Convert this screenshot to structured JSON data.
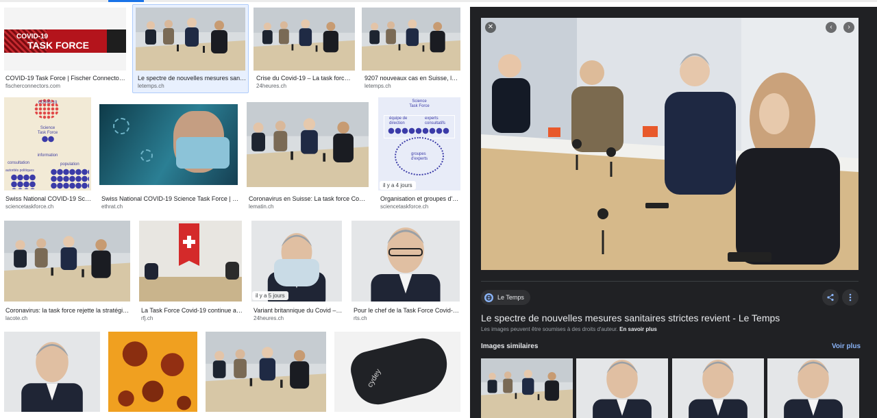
{
  "results": [
    {
      "title": "COVID-19 Task Force | Fischer Connectors S...",
      "source": "fischerconnectors.com",
      "banner_line1": "COVID-19",
      "banner_line2": "TASK FORCE"
    },
    {
      "title": "Le spectre de nouvelles mesures sanita...",
      "source": "letemps.ch",
      "selected": true
    },
    {
      "title": "Crise du Covid-19 – La task force p...",
      "source": "24heures.ch"
    },
    {
      "title": "9207 nouveaux cas en Suisse, la ca...",
      "source": "letemps.ch"
    },
    {
      "title": "Swiss National COVID-19 Scie...",
      "source": "sciencetaskforce.ch",
      "diagram": {
        "top": "COVID-19",
        "sub": "Science\nTask Force",
        "info": "information",
        "left": "consultation",
        "right": "population",
        "bottom": "autorités politiques"
      }
    },
    {
      "title": "Swiss National COVID-19 Science Task Force | Con...",
      "source": "ethrat.ch"
    },
    {
      "title": "Coronavirus en Suisse: La task force Covid-1...",
      "source": "lematin.ch"
    },
    {
      "title": "Organisation et groupes d'ex...",
      "source": "sciencetaskforce.ch",
      "badge": "il y a 4 jours",
      "diagram": {
        "top": "Science\nTask Force",
        "left": "équipe de\ndirection",
        "right": "experts\nconsultatifs",
        "bottom": "groupes\nd'experts"
      }
    },
    {
      "title": "Coronavirus: la task force rejette la stratégie d...",
      "source": "lacote.ch"
    },
    {
      "title": "La Task Force Covid-19 continue ave...",
      "source": "rfj.ch"
    },
    {
      "title": "Variant britannique du Covid – L...",
      "source": "24heures.ch",
      "badge": "il y a 5 jours"
    },
    {
      "title": "Pour le chef de la Task Force Covid-19, ...",
      "source": "rts.ch"
    },
    {
      "title": "",
      "source": ""
    },
    {
      "title": "",
      "source": ""
    },
    {
      "title": "",
      "source": ""
    },
    {
      "title": "",
      "source": "",
      "mask_text": "cydey"
    }
  ],
  "panel": {
    "source_name": "Le Temps",
    "title": "Le spectre de nouvelles mesures sanitaires strictes revient - Le Temps",
    "copyright_text": "Les images peuvent être soumises à des droits d'auteur.",
    "learn_more": "En savoir plus",
    "similar_heading": "Images similaires",
    "see_more": "Voir plus",
    "icons": {
      "close": "close-icon",
      "prev": "chevron-left-icon",
      "next": "chevron-right-icon",
      "share": "share-icon",
      "more": "more-vert-icon",
      "globe": "globe-icon"
    }
  },
  "colors": {
    "panel_bg": "#202124",
    "link": "#8ab4f8",
    "accent": "#1a73e8",
    "selected_bg": "#e8f0fe"
  }
}
